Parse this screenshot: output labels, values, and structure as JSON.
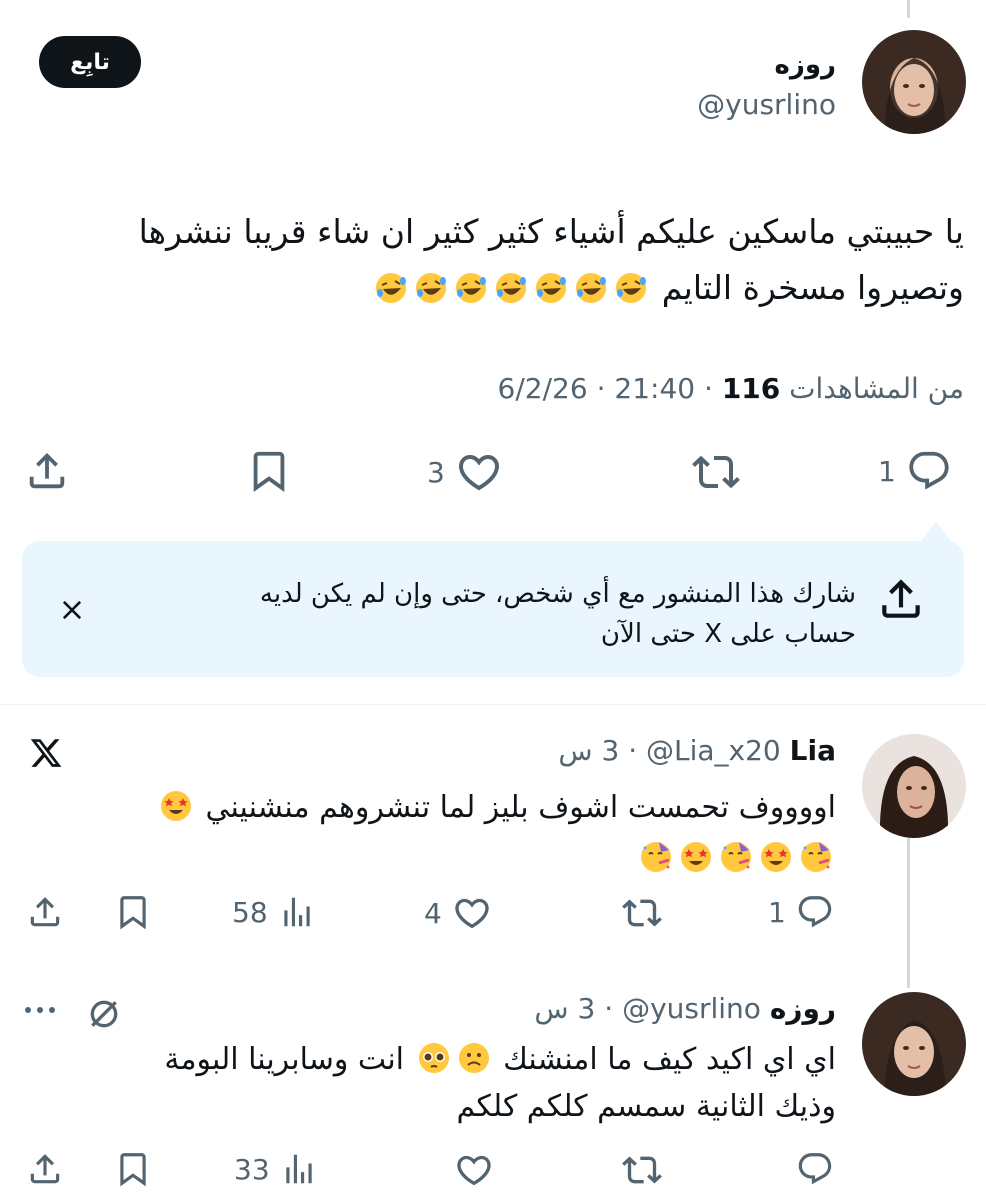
{
  "main_tweet": {
    "display_name": "روزه",
    "handle": "@yusrlino",
    "follow_label": "تابِع",
    "text_line1": "يا حبيبتي ماسكين عليكم أشياء كثير كثير ان شاء قريبا ننشرها",
    "text_line2": "وتصيروا مسخرة التايم",
    "emoji_count": 7,
    "date": "6/2/26",
    "time": "21:40",
    "views": "116",
    "views_label": "من المشاهدات",
    "replies": "1",
    "likes": "3",
    "icons": [
      "reply-icon",
      "retweet-icon",
      "like-icon",
      "bookmark-icon",
      "share-icon"
    ]
  },
  "share_prompt": {
    "line1": "شارك هذا المنشور مع أي شخص، حتى وإن لم يكن لديه",
    "line2": "حساب على X حتى الآن",
    "icons": [
      "share-icon",
      "close-icon"
    ]
  },
  "replies": [
    {
      "display_name": "Lia",
      "handle": "@Lia_x20",
      "time": "3 س",
      "text_line1": "اووووف تحمست اشوف بليز لما تنشروهم منشنيني",
      "emojis": [
        "star-struck",
        "partying",
        "star-struck",
        "partying",
        "star-struck",
        "partying"
      ],
      "replies": "1",
      "likes": "4",
      "views": "58",
      "badge_icon": "x-logo-icon"
    },
    {
      "display_name": "روزه",
      "handle": "@yusrlino",
      "time": "3 س",
      "text_line1": "اي اي اكيد كيف ما امنشنك",
      "text_line1b": "انت وسابرينا البومة",
      "text_line2": "وذيك الثانية سمسم كلكم كلكم",
      "emojis": [
        "slightly-frowning",
        "pleading"
      ],
      "views": "33",
      "icons": [
        "more-icon",
        "hidden-icon"
      ]
    }
  ],
  "colors": {
    "text": "#0f1419",
    "secondary": "#536471",
    "share_bg": "#e9f6fd",
    "thread_line": "#cfd9de"
  }
}
